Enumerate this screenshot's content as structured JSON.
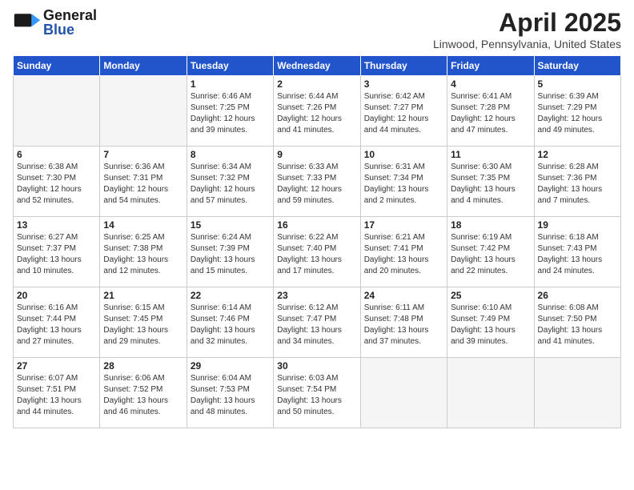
{
  "header": {
    "logo_general": "General",
    "logo_blue": "Blue",
    "month_title": "April 2025",
    "location": "Linwood, Pennsylvania, United States"
  },
  "days_of_week": [
    "Sunday",
    "Monday",
    "Tuesday",
    "Wednesday",
    "Thursday",
    "Friday",
    "Saturday"
  ],
  "weeks": [
    [
      {
        "num": "",
        "detail": "",
        "empty": true
      },
      {
        "num": "",
        "detail": "",
        "empty": true
      },
      {
        "num": "1",
        "detail": "Sunrise: 6:46 AM\nSunset: 7:25 PM\nDaylight: 12 hours and 39 minutes."
      },
      {
        "num": "2",
        "detail": "Sunrise: 6:44 AM\nSunset: 7:26 PM\nDaylight: 12 hours and 41 minutes."
      },
      {
        "num": "3",
        "detail": "Sunrise: 6:42 AM\nSunset: 7:27 PM\nDaylight: 12 hours and 44 minutes."
      },
      {
        "num": "4",
        "detail": "Sunrise: 6:41 AM\nSunset: 7:28 PM\nDaylight: 12 hours and 47 minutes."
      },
      {
        "num": "5",
        "detail": "Sunrise: 6:39 AM\nSunset: 7:29 PM\nDaylight: 12 hours and 49 minutes."
      }
    ],
    [
      {
        "num": "6",
        "detail": "Sunrise: 6:38 AM\nSunset: 7:30 PM\nDaylight: 12 hours and 52 minutes."
      },
      {
        "num": "7",
        "detail": "Sunrise: 6:36 AM\nSunset: 7:31 PM\nDaylight: 12 hours and 54 minutes."
      },
      {
        "num": "8",
        "detail": "Sunrise: 6:34 AM\nSunset: 7:32 PM\nDaylight: 12 hours and 57 minutes."
      },
      {
        "num": "9",
        "detail": "Sunrise: 6:33 AM\nSunset: 7:33 PM\nDaylight: 12 hours and 59 minutes."
      },
      {
        "num": "10",
        "detail": "Sunrise: 6:31 AM\nSunset: 7:34 PM\nDaylight: 13 hours and 2 minutes."
      },
      {
        "num": "11",
        "detail": "Sunrise: 6:30 AM\nSunset: 7:35 PM\nDaylight: 13 hours and 4 minutes."
      },
      {
        "num": "12",
        "detail": "Sunrise: 6:28 AM\nSunset: 7:36 PM\nDaylight: 13 hours and 7 minutes."
      }
    ],
    [
      {
        "num": "13",
        "detail": "Sunrise: 6:27 AM\nSunset: 7:37 PM\nDaylight: 13 hours and 10 minutes."
      },
      {
        "num": "14",
        "detail": "Sunrise: 6:25 AM\nSunset: 7:38 PM\nDaylight: 13 hours and 12 minutes."
      },
      {
        "num": "15",
        "detail": "Sunrise: 6:24 AM\nSunset: 7:39 PM\nDaylight: 13 hours and 15 minutes."
      },
      {
        "num": "16",
        "detail": "Sunrise: 6:22 AM\nSunset: 7:40 PM\nDaylight: 13 hours and 17 minutes."
      },
      {
        "num": "17",
        "detail": "Sunrise: 6:21 AM\nSunset: 7:41 PM\nDaylight: 13 hours and 20 minutes."
      },
      {
        "num": "18",
        "detail": "Sunrise: 6:19 AM\nSunset: 7:42 PM\nDaylight: 13 hours and 22 minutes."
      },
      {
        "num": "19",
        "detail": "Sunrise: 6:18 AM\nSunset: 7:43 PM\nDaylight: 13 hours and 24 minutes."
      }
    ],
    [
      {
        "num": "20",
        "detail": "Sunrise: 6:16 AM\nSunset: 7:44 PM\nDaylight: 13 hours and 27 minutes."
      },
      {
        "num": "21",
        "detail": "Sunrise: 6:15 AM\nSunset: 7:45 PM\nDaylight: 13 hours and 29 minutes."
      },
      {
        "num": "22",
        "detail": "Sunrise: 6:14 AM\nSunset: 7:46 PM\nDaylight: 13 hours and 32 minutes."
      },
      {
        "num": "23",
        "detail": "Sunrise: 6:12 AM\nSunset: 7:47 PM\nDaylight: 13 hours and 34 minutes."
      },
      {
        "num": "24",
        "detail": "Sunrise: 6:11 AM\nSunset: 7:48 PM\nDaylight: 13 hours and 37 minutes."
      },
      {
        "num": "25",
        "detail": "Sunrise: 6:10 AM\nSunset: 7:49 PM\nDaylight: 13 hours and 39 minutes."
      },
      {
        "num": "26",
        "detail": "Sunrise: 6:08 AM\nSunset: 7:50 PM\nDaylight: 13 hours and 41 minutes."
      }
    ],
    [
      {
        "num": "27",
        "detail": "Sunrise: 6:07 AM\nSunset: 7:51 PM\nDaylight: 13 hours and 44 minutes."
      },
      {
        "num": "28",
        "detail": "Sunrise: 6:06 AM\nSunset: 7:52 PM\nDaylight: 13 hours and 46 minutes."
      },
      {
        "num": "29",
        "detail": "Sunrise: 6:04 AM\nSunset: 7:53 PM\nDaylight: 13 hours and 48 minutes."
      },
      {
        "num": "30",
        "detail": "Sunrise: 6:03 AM\nSunset: 7:54 PM\nDaylight: 13 hours and 50 minutes."
      },
      {
        "num": "",
        "detail": "",
        "empty": true
      },
      {
        "num": "",
        "detail": "",
        "empty": true
      },
      {
        "num": "",
        "detail": "",
        "empty": true
      }
    ]
  ]
}
